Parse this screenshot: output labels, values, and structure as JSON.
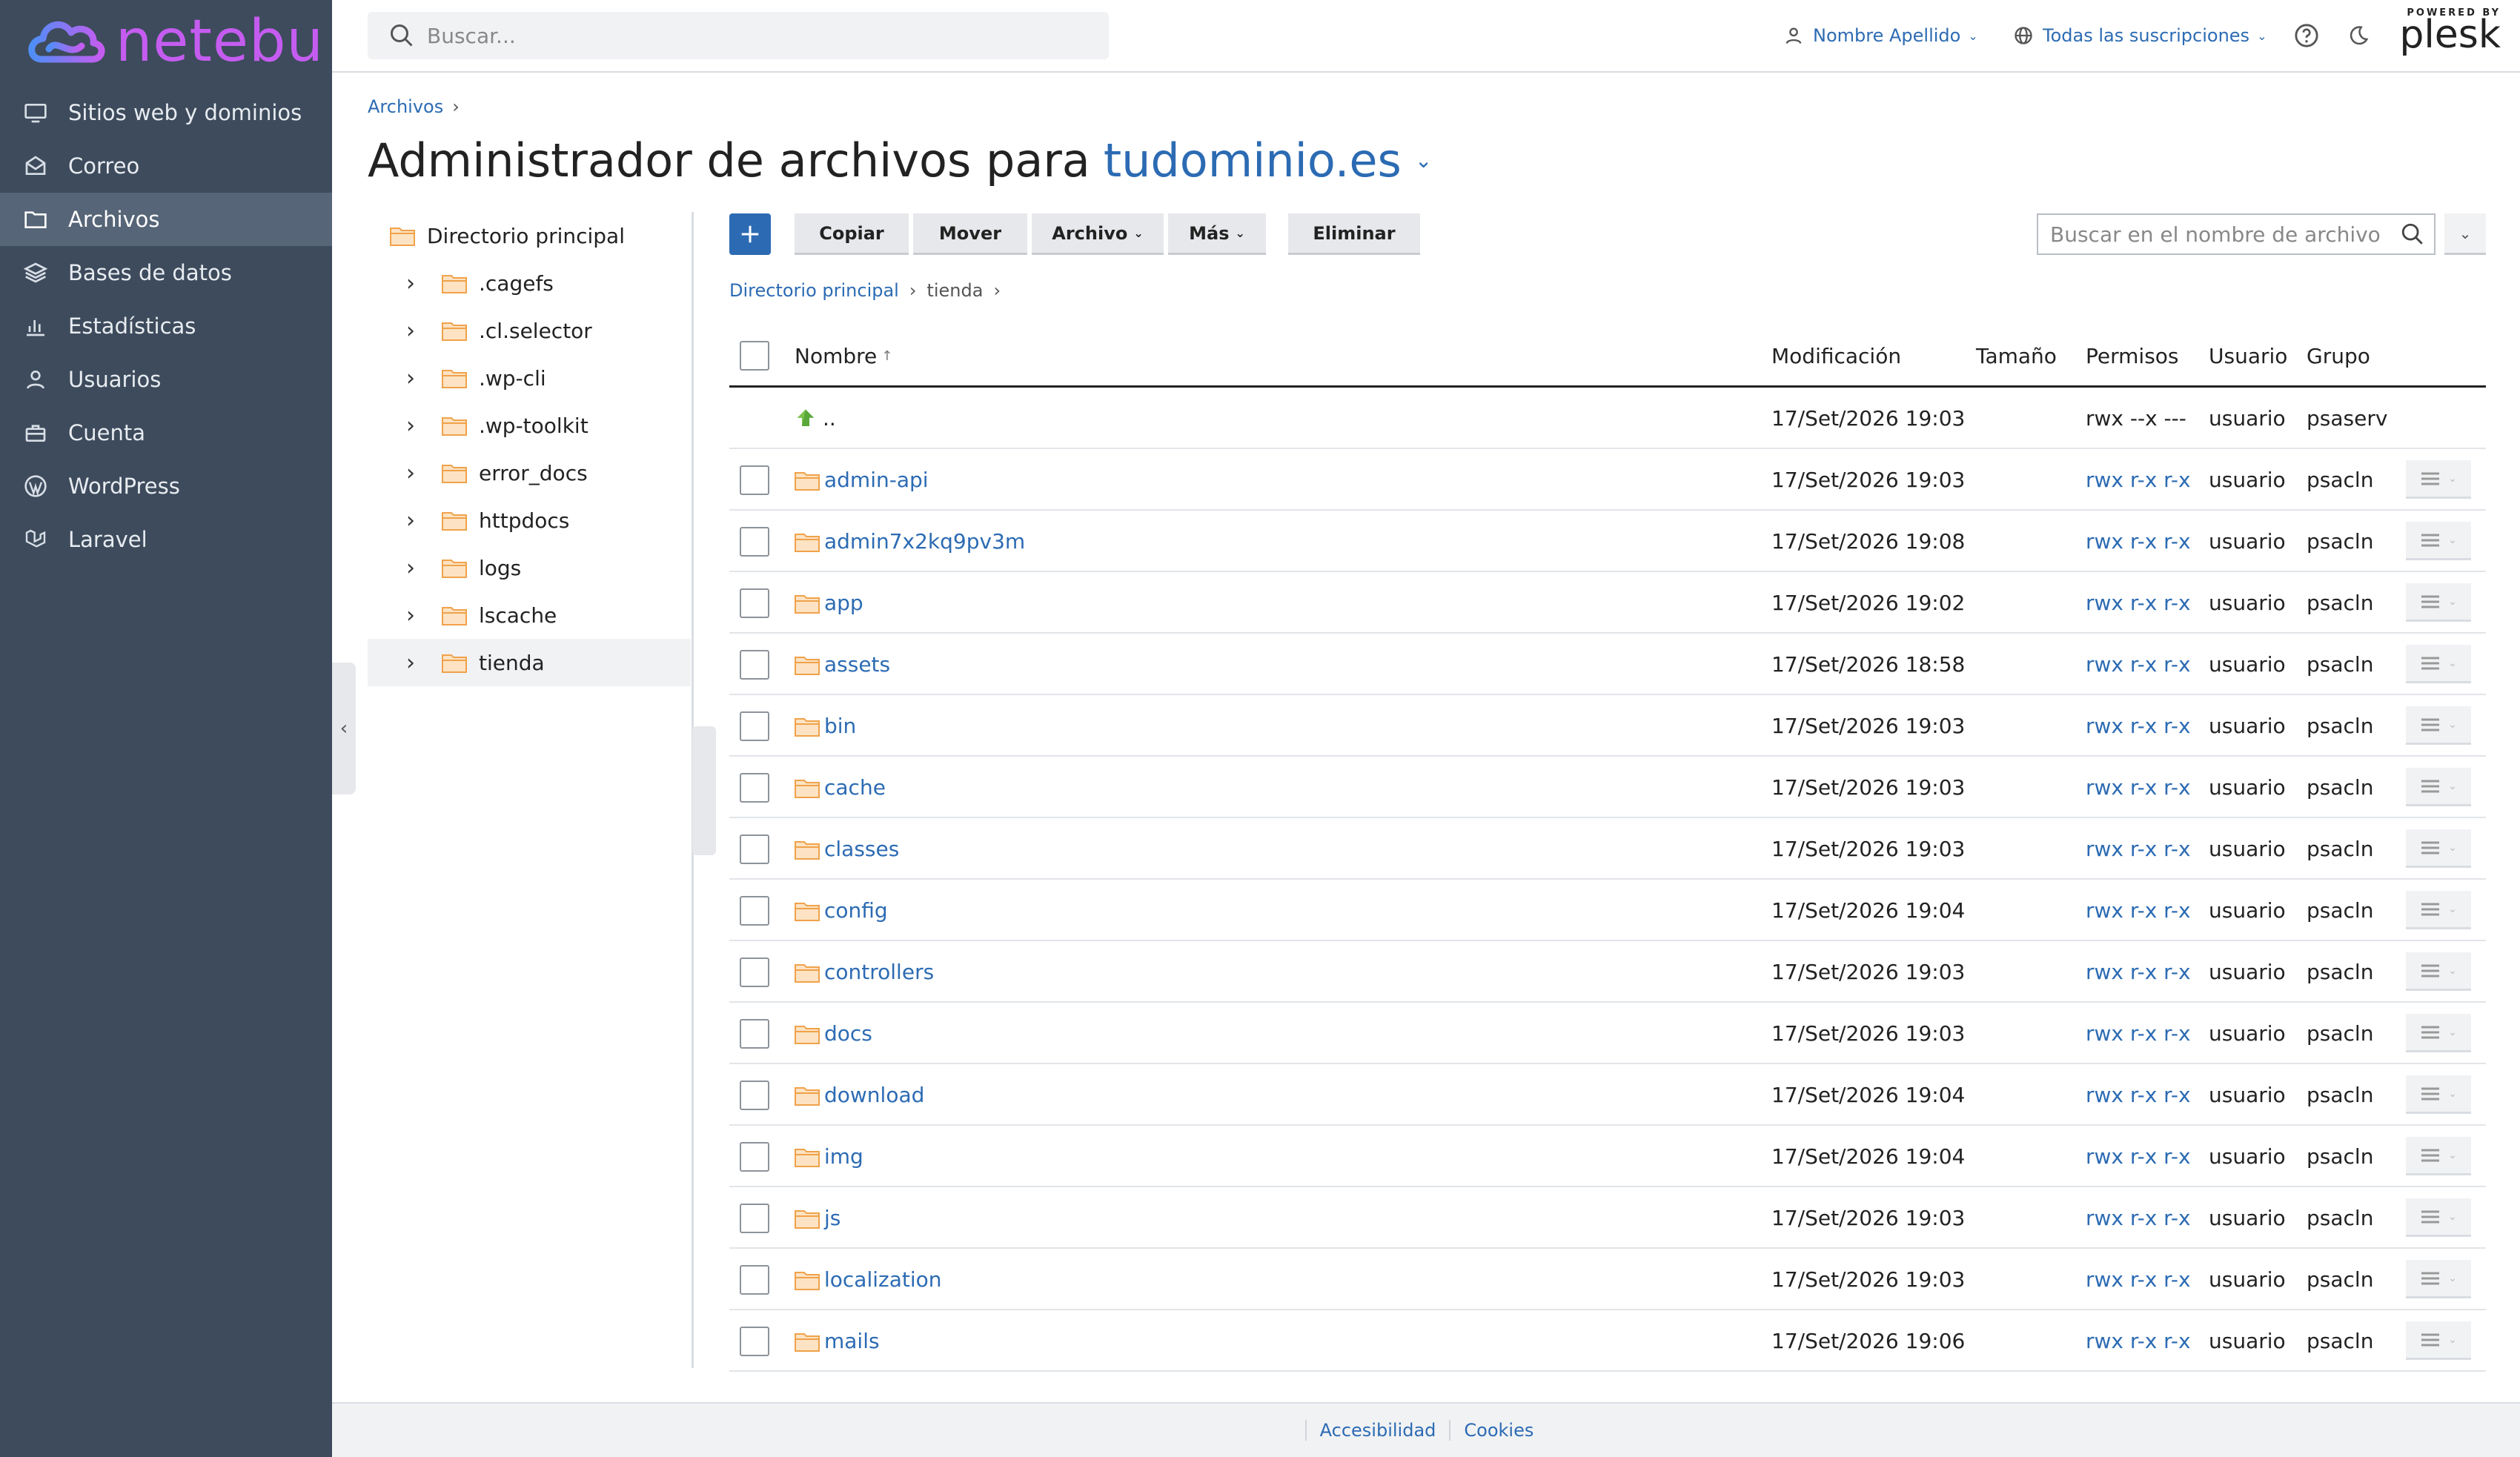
{
  "brand": {
    "logo_text": "netebu",
    "logo_colors": [
      "#4f8ef7",
      "#c55cf0"
    ]
  },
  "sidebar": {
    "items": [
      {
        "label": "Sitios web y dominios",
        "icon": "monitor-icon"
      },
      {
        "label": "Correo",
        "icon": "mail-icon"
      },
      {
        "label": "Archivos",
        "icon": "folder-icon",
        "active": true
      },
      {
        "label": "Bases de datos",
        "icon": "layers-icon"
      },
      {
        "label": "Estadísticas",
        "icon": "bar-chart-icon"
      },
      {
        "label": "Usuarios",
        "icon": "user-icon"
      },
      {
        "label": "Cuenta",
        "icon": "briefcase-icon"
      },
      {
        "label": "WordPress",
        "icon": "wordpress-icon"
      },
      {
        "label": "Laravel",
        "icon": "laravel-icon"
      }
    ]
  },
  "header": {
    "search_placeholder": "Buscar...",
    "user_name": "Nombre Apellido",
    "subscriptions": "Todas las suscripciones",
    "powered_by": "POWERED BY",
    "plesk": "plesk"
  },
  "breadcrumb": {
    "root": "Archivos"
  },
  "title": {
    "prefix": "Administrador de archivos para",
    "domain": "tudominio.es"
  },
  "tree": {
    "root": "Directorio principal",
    "children": [
      ".cagefs",
      ".cl.selector",
      ".wp-cli",
      ".wp-toolkit",
      "error_docs",
      "httpdocs",
      "logs",
      "lscache",
      "tienda"
    ],
    "selected": "tienda"
  },
  "toolbar": {
    "add_label": "+",
    "copy": "Copiar",
    "move": "Mover",
    "file": "Archivo",
    "more": "Más",
    "delete": "Eliminar",
    "search_placeholder": "Buscar en el nombre de archivo"
  },
  "path": {
    "root": "Directorio principal",
    "current": "tienda"
  },
  "table": {
    "headers": {
      "name": "Nombre",
      "name_sort": "↑",
      "modified": "Modificación",
      "size": "Tamaño",
      "perms": "Permisos",
      "user": "Usuario",
      "group": "Grupo"
    },
    "parent_row": {
      "name": "..",
      "modified": "17/Set/2026 19:03",
      "perms": "rwx --x ---",
      "user": "usuario",
      "group": "psaserv"
    },
    "rows": [
      {
        "name": "admin-api",
        "modified": "17/Set/2026 19:03",
        "perms": "rwx r-x r-x",
        "user": "usuario",
        "group": "psacln"
      },
      {
        "name": "admin7x2kq9pv3m",
        "modified": "17/Set/2026 19:08",
        "perms": "rwx r-x r-x",
        "user": "usuario",
        "group": "psacln"
      },
      {
        "name": "app",
        "modified": "17/Set/2026 19:02",
        "perms": "rwx r-x r-x",
        "user": "usuario",
        "group": "psacln"
      },
      {
        "name": "assets",
        "modified": "17/Set/2026 18:58",
        "perms": "rwx r-x r-x",
        "user": "usuario",
        "group": "psacln"
      },
      {
        "name": "bin",
        "modified": "17/Set/2026 19:03",
        "perms": "rwx r-x r-x",
        "user": "usuario",
        "group": "psacln"
      },
      {
        "name": "cache",
        "modified": "17/Set/2026 19:03",
        "perms": "rwx r-x r-x",
        "user": "usuario",
        "group": "psacln"
      },
      {
        "name": "classes",
        "modified": "17/Set/2026 19:03",
        "perms": "rwx r-x r-x",
        "user": "usuario",
        "group": "psacln"
      },
      {
        "name": "config",
        "modified": "17/Set/2026 19:04",
        "perms": "rwx r-x r-x",
        "user": "usuario",
        "group": "psacln"
      },
      {
        "name": "controllers",
        "modified": "17/Set/2026 19:03",
        "perms": "rwx r-x r-x",
        "user": "usuario",
        "group": "psacln"
      },
      {
        "name": "docs",
        "modified": "17/Set/2026 19:03",
        "perms": "rwx r-x r-x",
        "user": "usuario",
        "group": "psacln"
      },
      {
        "name": "download",
        "modified": "17/Set/2026 19:04",
        "perms": "rwx r-x r-x",
        "user": "usuario",
        "group": "psacln"
      },
      {
        "name": "img",
        "modified": "17/Set/2026 19:04",
        "perms": "rwx r-x r-x",
        "user": "usuario",
        "group": "psacln"
      },
      {
        "name": "js",
        "modified": "17/Set/2026 19:03",
        "perms": "rwx r-x r-x",
        "user": "usuario",
        "group": "psacln"
      },
      {
        "name": "localization",
        "modified": "17/Set/2026 19:03",
        "perms": "rwx r-x r-x",
        "user": "usuario",
        "group": "psacln"
      },
      {
        "name": "mails",
        "modified": "17/Set/2026 19:06",
        "perms": "rwx r-x r-x",
        "user": "usuario",
        "group": "psacln"
      }
    ]
  },
  "footer": {
    "accessibility": "Accesibilidad",
    "cookies": "Cookies"
  },
  "colors": {
    "sidebar": "#3d4b5c",
    "sidebar_active": "#566577",
    "link": "#2c6bb3",
    "folder": "#f0a24a",
    "primary_button": "#2c6bb3"
  }
}
